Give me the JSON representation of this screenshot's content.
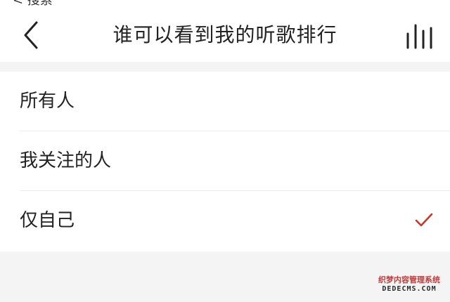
{
  "header": {
    "back_hint": "< 搜索",
    "title": "谁可以看到我的听歌排行",
    "back_icon": "chevron-left-icon",
    "right_icon": "bars-icon"
  },
  "options": [
    {
      "label": "所有人",
      "selected": false
    },
    {
      "label": "我关注的人",
      "selected": false
    },
    {
      "label": "仅自己",
      "selected": true
    }
  ],
  "colors": {
    "accent": "#c0392b",
    "background": "#f4f4f4",
    "surface": "#ffffff"
  },
  "watermark": {
    "top": "织梦内容管理系统",
    "bottom": "DEDECMS.COM"
  }
}
